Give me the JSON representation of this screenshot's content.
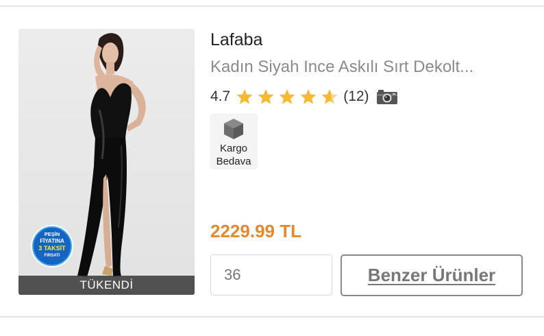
{
  "product": {
    "brand": "Lafaba",
    "title": "Kadın Siyah Ince Askılı Sırt Dekolt...",
    "rating": "4.7",
    "stars": 4.7,
    "review_count": "(12)",
    "badge": {
      "icon": "package-box-icon",
      "line1": "Kargo",
      "line2": "Bedava"
    },
    "price": "2229.99 TL",
    "sold_out_label": "TÜKENDİ",
    "promo_badge": {
      "line1": "PEŞİN",
      "line2": "FİYATINA",
      "line3": "3 TAKSİT",
      "line4": "FIRSATI"
    }
  },
  "size_select": {
    "placeholder": "36"
  },
  "actions": {
    "similar_label": "Benzer Ürünler"
  },
  "colors": {
    "price": "#e6892c",
    "star": "#f5b932",
    "promo_blue": "#1565c0"
  }
}
